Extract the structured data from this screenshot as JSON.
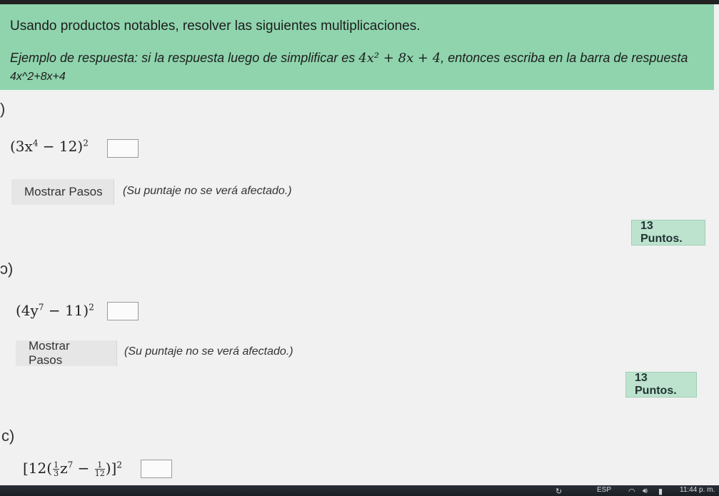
{
  "instructions": {
    "title": "Usando productos notables, resolver las siguientes multiplicaciones.",
    "example_prefix": "Ejemplo de respuesta: si la respuesta luego de simplificar es",
    "example_math": "4x² + 8x + 4",
    "example_suffix": ", entonces escriba en la barra de respuesta",
    "example_answer": "4x^2+8x+4"
  },
  "problems": [
    {
      "label": ")",
      "base": "(3x",
      "inner_exp": "4",
      "rest": " − 12)",
      "outer_exp": "2",
      "show_steps": "Mostrar Pasos",
      "note": "(Su puntaje no se verá afectado.)",
      "points": "13 Puntos."
    },
    {
      "label": "ɔ)",
      "base": "(4y",
      "inner_exp": "7",
      "rest": " − 11)",
      "outer_exp": "2",
      "show_steps": "Mostrar Pasos",
      "note": "(Su puntaje no se verá afectado.)",
      "points": "13 Puntos."
    },
    {
      "label": "c)",
      "open": "[12(",
      "frac1_num": "1",
      "frac1_den": "3",
      "mid": "z",
      "mid_exp": "7",
      "minus": " − ",
      "frac2_num": "1",
      "frac2_den": "12",
      "close": ")]",
      "outer_exp": "2"
    }
  ],
  "taskbar": {
    "language": "ESP",
    "time": "11:44 p. m.",
    "icons": [
      "refresh-icon",
      "wifi-icon",
      "speaker-icon",
      "battery-icon"
    ]
  }
}
